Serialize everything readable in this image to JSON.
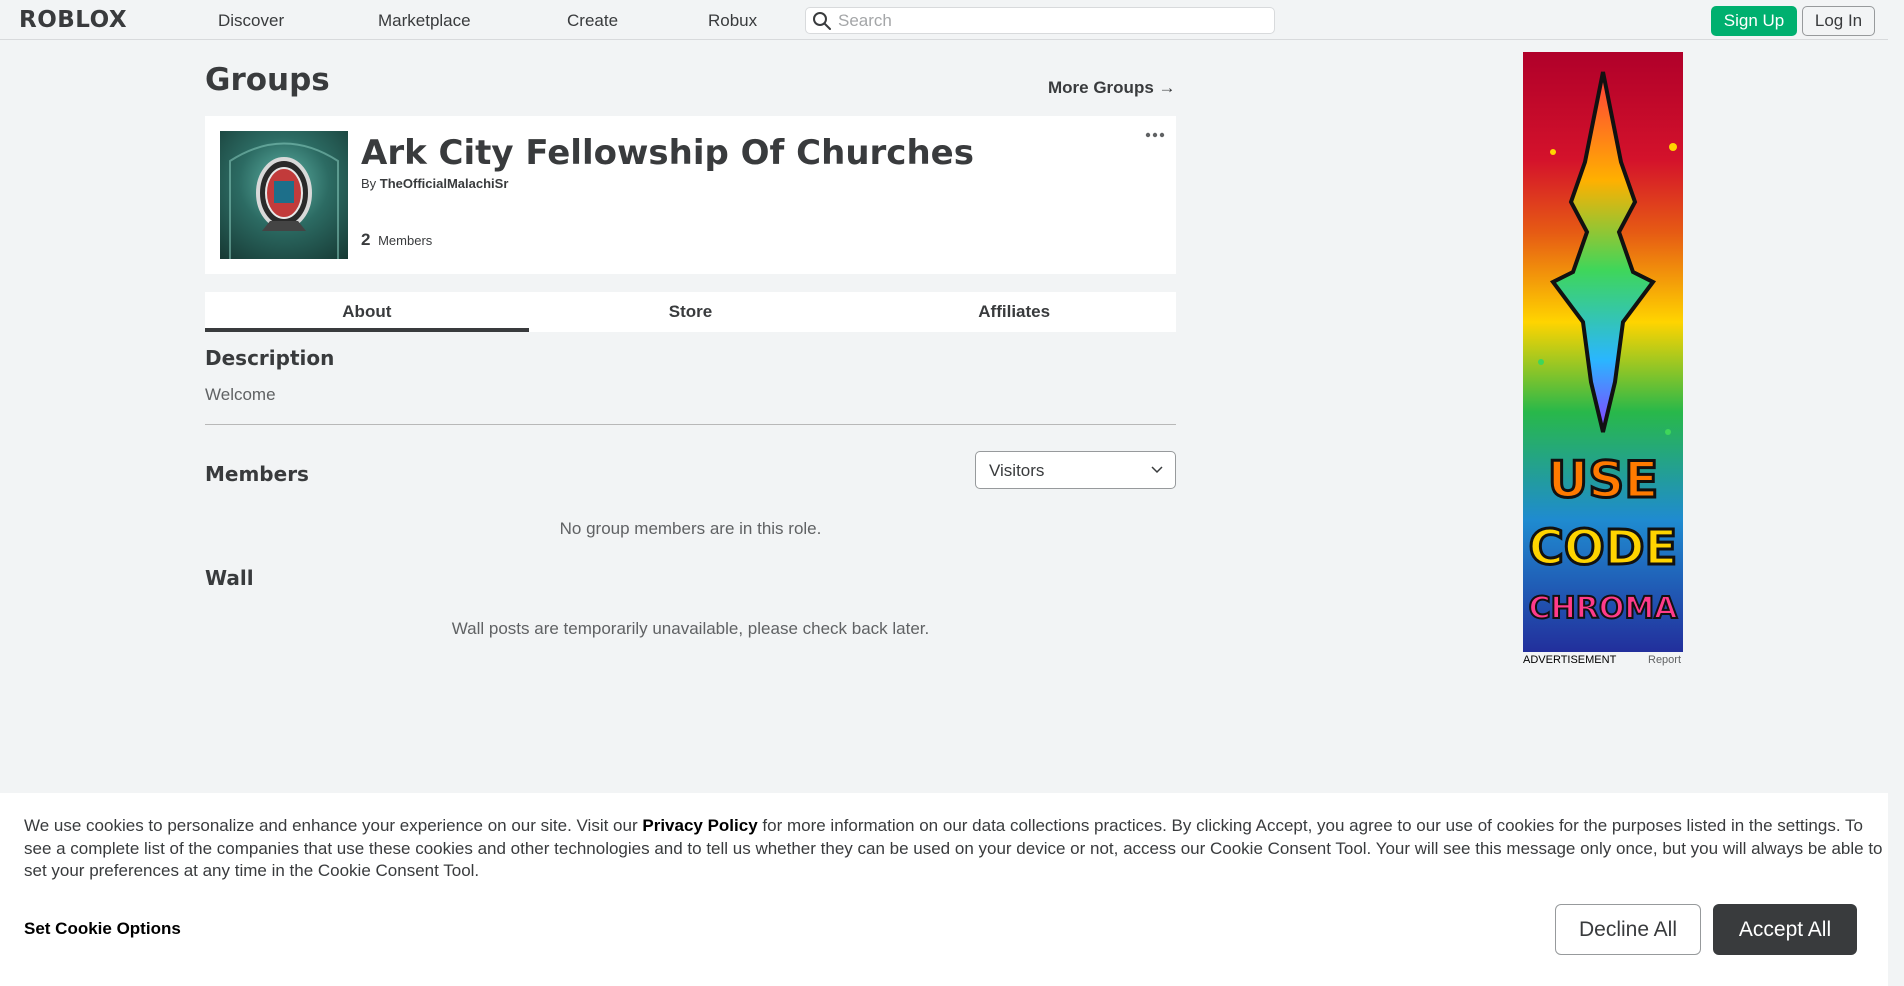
{
  "header": {
    "logo_text": "ROBLOX",
    "nav": [
      "Discover",
      "Marketplace",
      "Create",
      "Robux"
    ],
    "search_placeholder": "Search",
    "signup_label": "Sign Up",
    "login_label": "Log In"
  },
  "page": {
    "title": "Groups",
    "more_groups": "More Groups →"
  },
  "group": {
    "name": "Ark City Fellowship Of Churches",
    "by_label": "By",
    "owner": "TheOfficialMalachiSr",
    "member_count": "2",
    "members_label": "Members"
  },
  "tabs": [
    "About",
    "Store",
    "Affiliates"
  ],
  "about": {
    "description_title": "Description",
    "description_text": "Welcome",
    "members_title": "Members",
    "role_selected": "Visitors",
    "members_empty": "No group members are in this role.",
    "wall_title": "Wall",
    "wall_empty": "Wall posts are temporarily unavailable, please check back later."
  },
  "ad": {
    "label": "ADVERTISEMENT",
    "report": "Report",
    "lines": [
      "USE",
      "CODE",
      "CHROMA"
    ]
  },
  "cookie": {
    "text_before": "We use cookies to personalize and enhance your experience on our site. Visit our ",
    "privacy_link": "Privacy Policy",
    "text_after": " for more information on our data collections practices. By clicking Accept, you agree to our use of cookies for the purposes listed in the settings. To see a complete list of the companies that use these cookies and other technologies and to tell us whether they can be used on your device or not, access our Cookie Consent Tool. Your will see this message only once, but you will always be able to set your preferences at any time in the Cookie Consent Tool.",
    "options_label": "Set Cookie Options",
    "decline_label": "Decline All",
    "accept_label": "Accept All"
  },
  "colors": {
    "signup": "#00b06f",
    "accept": "#393b3d",
    "text": "#393b3d",
    "muted": "#606264"
  }
}
